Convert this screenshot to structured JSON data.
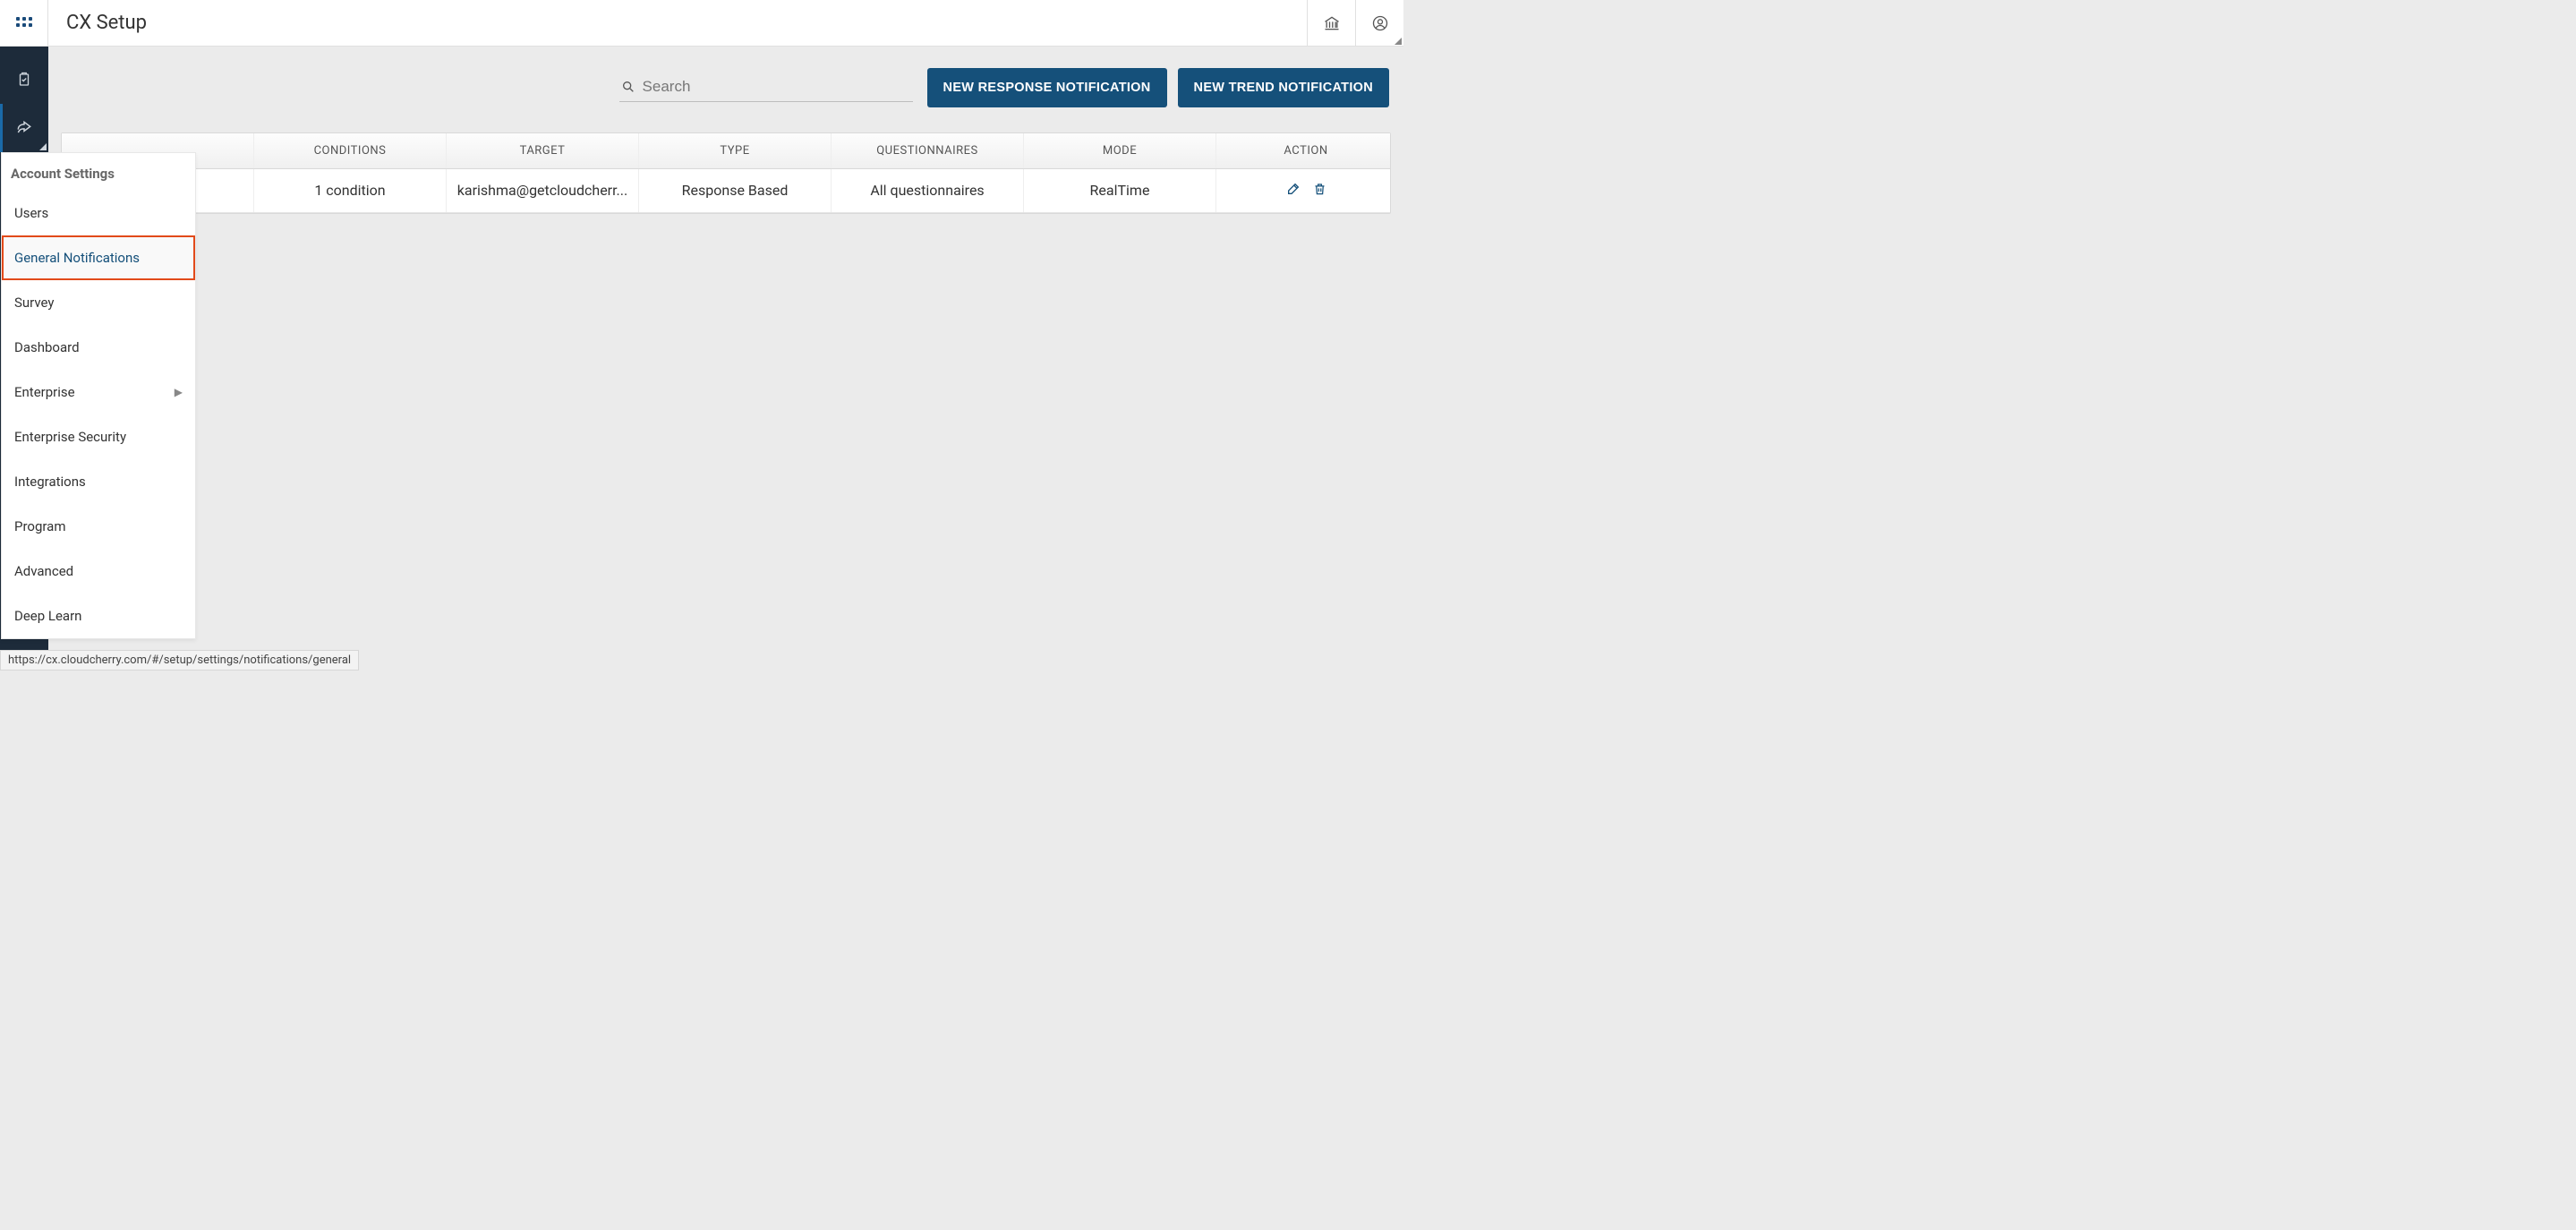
{
  "header": {
    "title": "CX Setup"
  },
  "search": {
    "placeholder": "Search"
  },
  "buttons": {
    "new_response": "NEW RESPONSE NOTIFICATION",
    "new_trend": "NEW TREND NOTIFICATION"
  },
  "table": {
    "headers": {
      "name": "",
      "conditions": "CONDITIONS",
      "target": "TARGET",
      "type": "TYPE",
      "questionnaires": "QUESTIONNAIRES",
      "mode": "MODE",
      "action": "ACTION"
    },
    "rows": [
      {
        "name": "",
        "conditions": "1 condition",
        "target": "karishma@getcloudcherr...",
        "type": "Response Based",
        "questionnaires": "All questionnaires",
        "mode": "RealTime"
      }
    ]
  },
  "sidebar": {
    "heading": "Account Settings",
    "items": [
      {
        "label": "Users",
        "submenu": false,
        "highlighted": false
      },
      {
        "label": "General Notifications",
        "submenu": false,
        "highlighted": true
      },
      {
        "label": "Survey",
        "submenu": false,
        "highlighted": false
      },
      {
        "label": "Dashboard",
        "submenu": false,
        "highlighted": false
      },
      {
        "label": "Enterprise",
        "submenu": true,
        "highlighted": false
      },
      {
        "label": "Enterprise Security",
        "submenu": false,
        "highlighted": false
      },
      {
        "label": "Integrations",
        "submenu": false,
        "highlighted": false
      },
      {
        "label": "Program",
        "submenu": false,
        "highlighted": false
      },
      {
        "label": "Advanced",
        "submenu": false,
        "highlighted": false
      },
      {
        "label": "Deep Learn",
        "submenu": false,
        "highlighted": false
      }
    ]
  },
  "status_url": "https://cx.cloudcherry.com/#/setup/settings/notifications/general"
}
